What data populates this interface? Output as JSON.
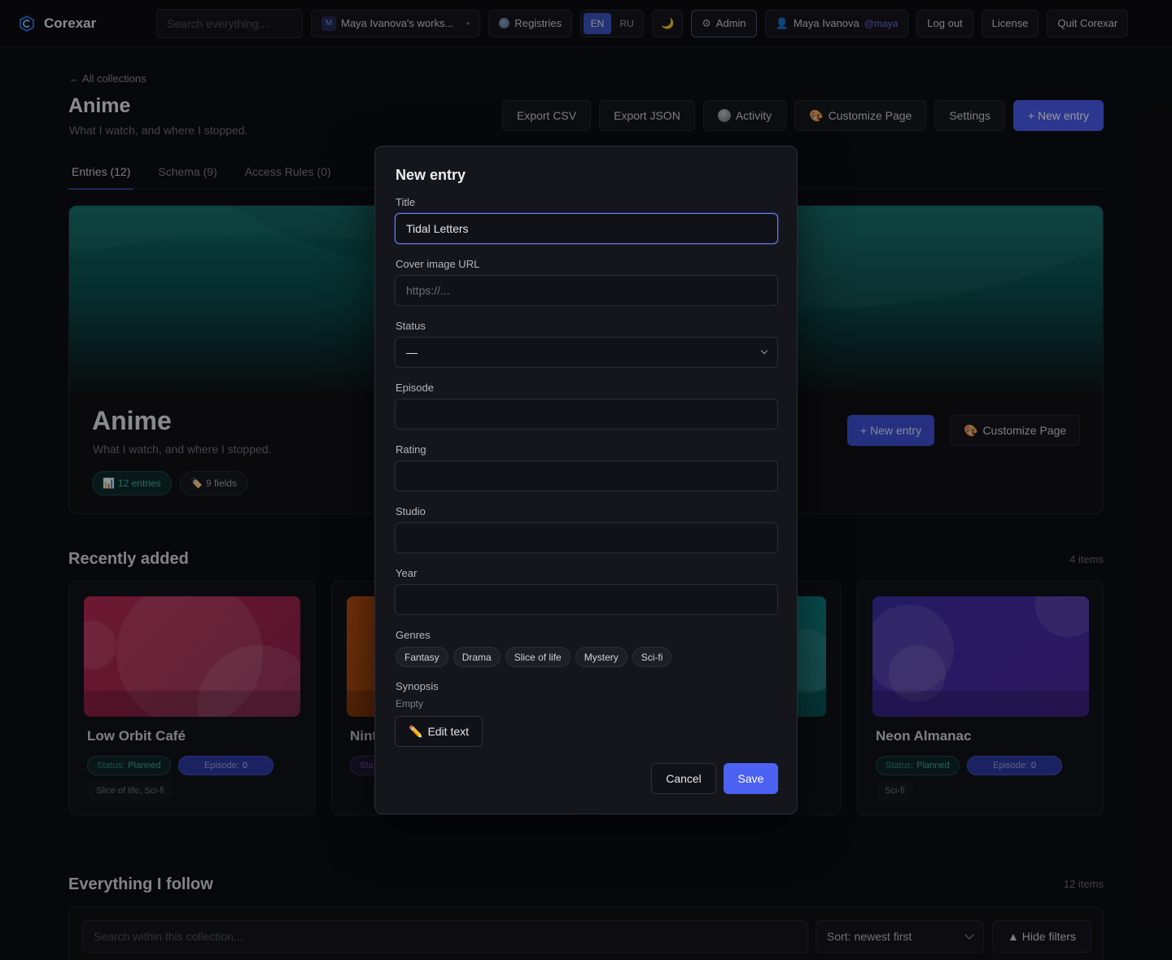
{
  "topbar": {
    "brand": "Corexar",
    "search_placeholder": "Search everything...",
    "workspace_initial": "M",
    "workspace_label": "Maya Ivanova's works...",
    "registries": "Registries",
    "lang_en": "EN",
    "lang_ru": "RU",
    "theme_icon": "🌙",
    "admin": "Admin",
    "user_name": "Maya Ivanova",
    "user_handle": "@maya",
    "logout": "Log out",
    "license": "License",
    "quit": "Quit Corexar"
  },
  "page": {
    "back": "← All collections",
    "title": "Anime",
    "subtitle": "What I watch, and where I stopped.",
    "actions": {
      "export_csv": "Export CSV",
      "export_json": "Export JSON",
      "activity": "Activity",
      "customize": "Customize Page",
      "settings": "Settings",
      "new_entry": "+ New entry"
    },
    "tabs": {
      "entries": "Entries (12)",
      "schema": "Schema (9)",
      "access": "Access Rules (0)"
    }
  },
  "hero": {
    "title": "Anime",
    "subtitle": "What I watch, and where I stopped.",
    "entries_icon": "📊",
    "entries": "12 entries",
    "fields_icon": "🏷️",
    "fields": "9 fields",
    "new_entry": "+ New entry",
    "customize": "Customize Page",
    "colors": {
      "top": "#0e6d68",
      "mid": "#0b4a4a"
    }
  },
  "recent": {
    "title": "Recently added",
    "count": "4 items",
    "cards": [
      {
        "title": "Low Orbit Café",
        "status_key": "Status:",
        "status": "Planned",
        "episode_key": "Episode:",
        "episode": "0",
        "genres": "Slice of life, Sci-fi",
        "color": "#b0284f"
      },
      {
        "title": "Nint",
        "status_key": "Sta",
        "color": "#b44a10"
      },
      {
        "color": "#138a8a"
      },
      {
        "title": "Neon Almanac",
        "status_key": "Status:",
        "status": "Planned",
        "episode_key": "Episode:",
        "episode": "0",
        "genres": "Sci-fi",
        "color": "#3b2a9c"
      }
    ]
  },
  "follow": {
    "title": "Everything I follow",
    "count": "12 items",
    "search_placeholder": "Search within this collection...",
    "sort": "Sort: newest first",
    "hide_filters": "▲ Hide filters"
  },
  "modal": {
    "title": "New entry",
    "title_label": "Title",
    "title_value": "Tidal Letters",
    "cover_label": "Cover image URL",
    "cover_placeholder": "https://...",
    "status_label": "Status",
    "status_value": "—",
    "episode_label": "Episode",
    "rating_label": "Rating",
    "studio_label": "Studio",
    "year_label": "Year",
    "genres_label": "Genres",
    "genres": [
      "Fantasy",
      "Drama",
      "Slice of life",
      "Mystery",
      "Sci-fi"
    ],
    "synopsis_label": "Synopsis",
    "synopsis_empty": "Empty",
    "edit_text": "Edit text",
    "edit_icon": "✏️",
    "cancel": "Cancel",
    "save": "Save"
  }
}
